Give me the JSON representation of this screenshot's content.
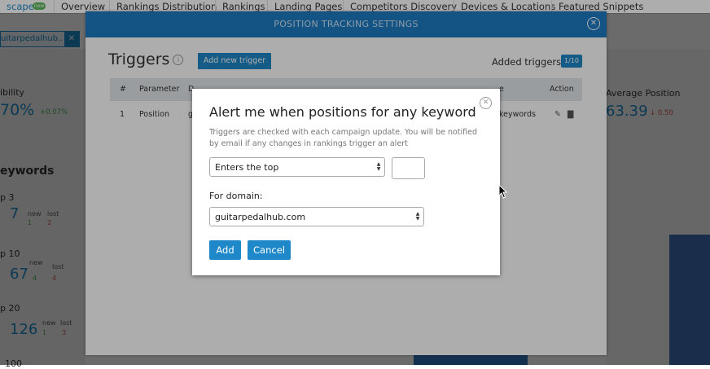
{
  "tabs": [
    "scape",
    "Overview",
    "Rankings Distribution",
    "Rankings",
    "Landing Pages",
    "Competitors Discovery",
    "Devices & Locations",
    "Featured Snippets"
  ],
  "new_badge": "new",
  "filter_chip": {
    "label": "uitarpedalhub...",
    "close": "✕"
  },
  "background": {
    "visibility_label": "ibility",
    "visibility_value": "70%",
    "visibility_delta": "+0.07%",
    "avg_position_label": "Average Position",
    "avg_position_value": "63.39",
    "avg_position_delta": "↓ 0.50",
    "keywords_title": "eywords",
    "rows": [
      {
        "label": "p 3",
        "value": "7",
        "new_label": "new",
        "new_value": "1",
        "lost_label": "lost",
        "lost_value": "2"
      },
      {
        "label": "p 10",
        "value": "67",
        "new_label": "new",
        "new_value": "4",
        "lost_label": "lost",
        "lost_value": "4"
      },
      {
        "label": "p 20",
        "value": "126",
        "new_label": "new",
        "new_value": "1",
        "lost_label": "lost",
        "lost_value": "3"
      }
    ],
    "last_label": "100"
  },
  "settings_panel": {
    "title": "POSITION TRACKING SETTINGS",
    "triggers_title": "Triggers",
    "add_button": "Add new trigger",
    "added_label": "Added triggers",
    "added_count": "1/10",
    "columns": {
      "num": "#",
      "parameter": "Parameter",
      "col3": "D",
      "action": "Action",
      "keywords_partial": "e"
    },
    "row": {
      "num": "1",
      "parameter": "Position",
      "col3": "g",
      "keywords": "keywords"
    }
  },
  "modal": {
    "title": "Alert me when positions for any keyword",
    "description": "Triggers are checked with each campaign update. You will be notified by email if any changes in rankings trigger an alert",
    "condition_value": "Enters the top",
    "top_value": "",
    "domain_label": "For domain:",
    "domain_value": "guitarpedalhub.com",
    "add_button": "Add",
    "cancel_button": "Cancel"
  },
  "colors": {
    "accent": "#1e88c8",
    "header_blue": "#1e7cc4",
    "positive": "#4caf50",
    "negative": "#d9534f"
  }
}
